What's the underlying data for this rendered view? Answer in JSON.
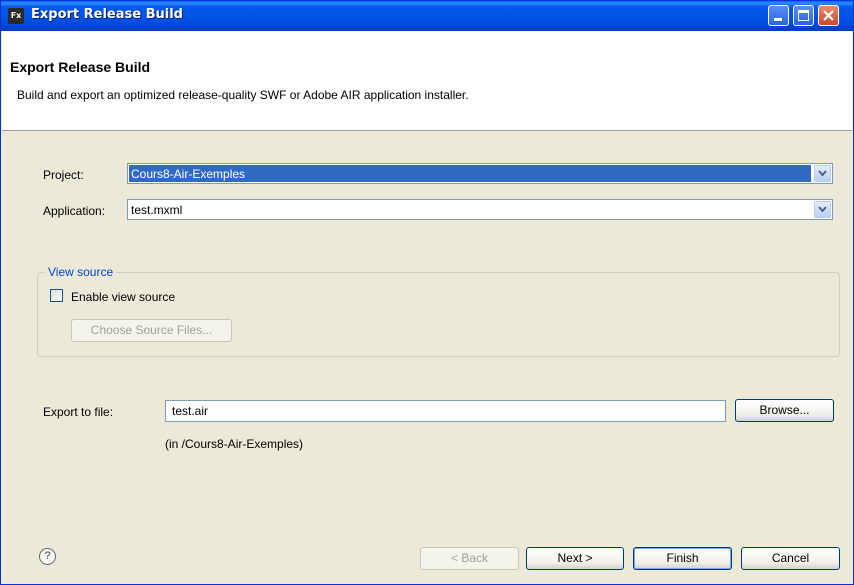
{
  "window": {
    "icon_text": "Fx",
    "title": "Export Release Build"
  },
  "header": {
    "title": "Export Release Build",
    "description": "Build and export an optimized release-quality SWF or Adobe AIR application installer."
  },
  "form": {
    "project_label": "Project:",
    "project_value": "Cours8-Air-Exemples",
    "application_label": "Application:",
    "application_value": "test.mxml"
  },
  "view_source": {
    "group_title": "View source",
    "enable_label": "Enable view source",
    "enable_checked": false,
    "choose_button": "Choose Source Files..."
  },
  "export": {
    "label": "Export to file:",
    "value": "test.air",
    "browse_button": "Browse...",
    "path_note": "(in /Cours8-Air-Exemples)"
  },
  "footer": {
    "help_glyph": "?",
    "back_button": "< Back",
    "next_button": "Next >",
    "finish_button": "Finish",
    "cancel_button": "Cancel"
  },
  "colors": {
    "titlebar": "#0054e3",
    "dialog_bg": "#ece9d8",
    "selection": "#316ac5",
    "group_title": "#0046d5"
  }
}
